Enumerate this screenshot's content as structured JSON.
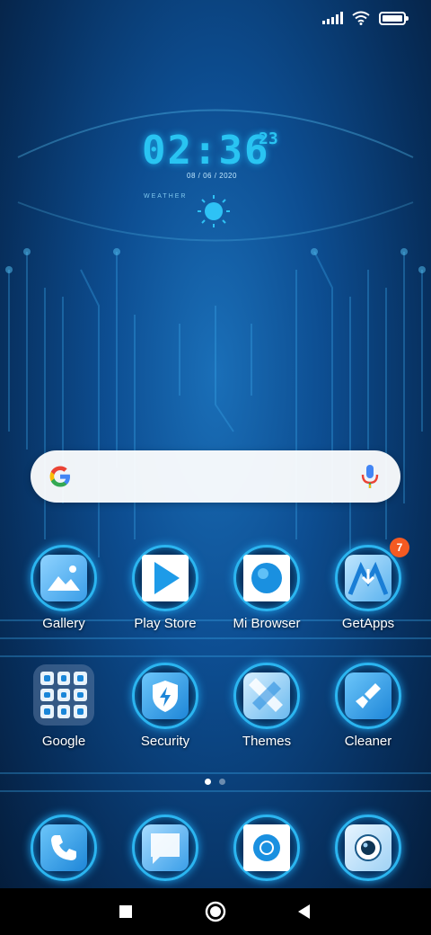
{
  "status_bar": {
    "signal_icon": "signal-bars-icon",
    "wifi_icon": "wifi-icon",
    "battery_icon": "battery-icon",
    "battery_level": 1.0
  },
  "clock": {
    "time": "02:36",
    "seconds": "23",
    "date": "08 / 06 / 2020",
    "weather_label": "WEATHER",
    "weather_icon": "sun-icon"
  },
  "search": {
    "logo_icon": "google-g-icon",
    "mic_icon": "microphone-icon"
  },
  "apps_row1": [
    {
      "label": "Gallery",
      "icon": "gallery-icon"
    },
    {
      "label": "Play Store",
      "icon": "play-store-icon"
    },
    {
      "label": "Mi Browser",
      "icon": "mi-browser-icon"
    },
    {
      "label": "GetApps",
      "icon": "getapps-icon",
      "badge": "7"
    }
  ],
  "apps_row2": [
    {
      "label": "Google",
      "icon": "folder-icon"
    },
    {
      "label": "Security",
      "icon": "security-shield-icon"
    },
    {
      "label": "Themes",
      "icon": "themes-brush-icon"
    },
    {
      "label": "Cleaner",
      "icon": "cleaner-brush-icon"
    }
  ],
  "dock": [
    {
      "icon": "phone-icon"
    },
    {
      "icon": "messages-icon"
    },
    {
      "icon": "chrome-icon"
    },
    {
      "icon": "camera-icon"
    }
  ],
  "page_indicator": {
    "total": 2,
    "current": 1
  },
  "nav": {
    "recents_icon": "recents-square-icon",
    "home_icon": "home-circle-icon",
    "back_icon": "back-triangle-icon"
  },
  "colors": {
    "accent": "#2bb5f0",
    "badge": "#f45a22"
  }
}
